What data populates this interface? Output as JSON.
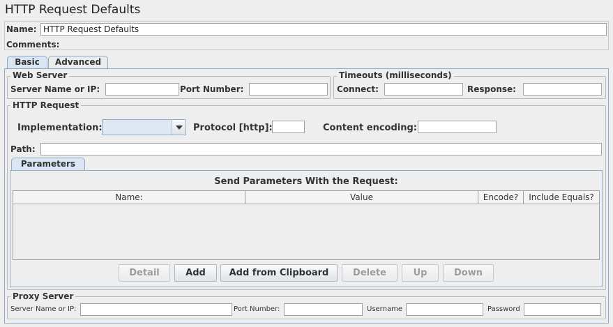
{
  "title": "HTTP Request Defaults",
  "name_label": "Name:",
  "name_value": "HTTP Request Defaults",
  "comments_label": "Comments:",
  "tabs": [
    {
      "label": "Basic",
      "active": true
    },
    {
      "label": "Advanced",
      "active": false
    }
  ],
  "web_server": {
    "title": "Web Server",
    "server_label": "Server Name or IP:",
    "server_value": "",
    "port_label": "Port Number:",
    "port_value": ""
  },
  "timeouts": {
    "title": "Timeouts (milliseconds)",
    "connect_label": "Connect:",
    "connect_value": "",
    "response_label": "Response:",
    "response_value": ""
  },
  "http_request": {
    "title": "HTTP Request",
    "implementation_label": "Implementation:",
    "implementation_value": "",
    "protocol_label": "Protocol [http]:",
    "protocol_value": "",
    "encoding_label": "Content encoding:",
    "encoding_value": "",
    "path_label": "Path:",
    "path_value": ""
  },
  "parameters": {
    "tab_label": "Parameters",
    "heading": "Send Parameters With the Request:",
    "columns": [
      "Name:",
      "Value",
      "Encode?",
      "Include Equals?"
    ],
    "rows": [],
    "buttons": {
      "detail": "Detail",
      "add": "Add",
      "add_clipboard": "Add from Clipboard",
      "delete": "Delete",
      "up": "Up",
      "down": "Down"
    }
  },
  "proxy": {
    "title": "Proxy Server",
    "server_label": "Server Name or IP:",
    "server_value": "",
    "port_label": "Port Number:",
    "port_value": "",
    "username_label": "Username",
    "username_value": "",
    "password_label": "Password",
    "password_value": ""
  },
  "colors": {
    "background": "#eeeeee",
    "tab_active": "#dbe6f4",
    "tab_border": "#8fa9c4",
    "disabled_text": "#9c9c9c"
  }
}
